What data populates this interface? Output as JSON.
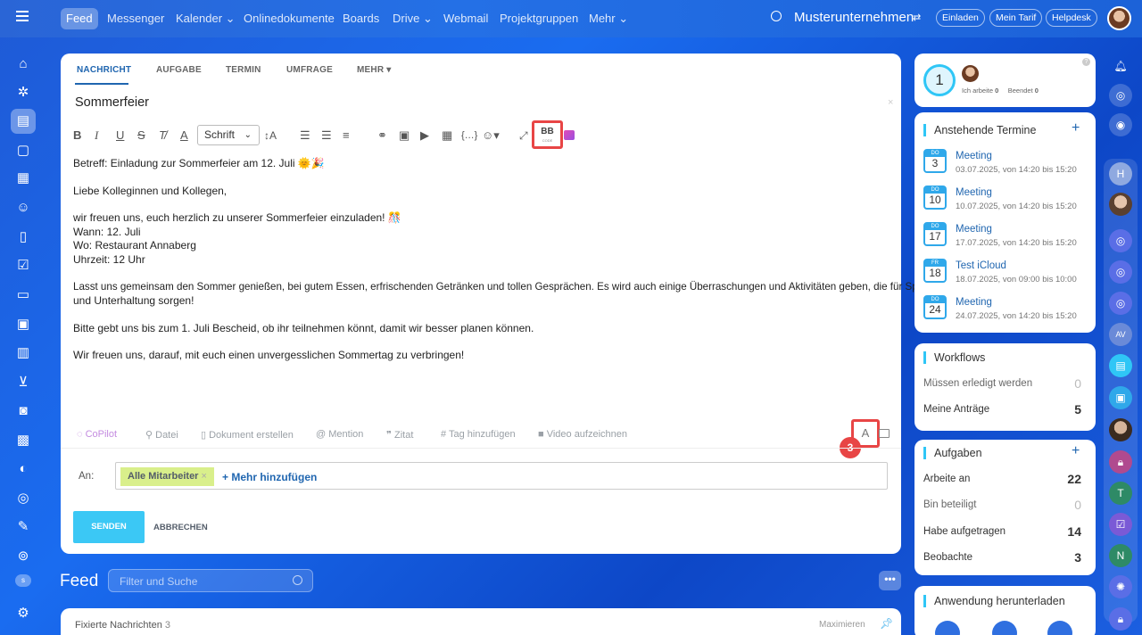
{
  "topnav": {
    "items": [
      "Feed",
      "Messenger",
      "Kalender",
      "Onlinedokumente",
      "Boards",
      "Drive",
      "Webmail",
      "Projektgruppen",
      "Mehr"
    ],
    "company": "Musterunternehmen",
    "invite": "Einladen",
    "tariff": "Mein Tarif",
    "helpdesk": "Helpdesk"
  },
  "composer": {
    "tabs": [
      "NACHRICHT",
      "AUFGABE",
      "TERMIN",
      "UMFRAGE",
      "MEHR"
    ],
    "title": "Sommerfeier",
    "font_select": "Schrift",
    "bb_label": "BB",
    "bb_sub": "CODE",
    "body": [
      "Betreff: Einladung zur Sommerfeier am 12. Juli 🌞🎉",
      "Liebe Kolleginnen und Kollegen,",
      "wir freuen uns, euch herzlich zu unserer Sommerfeier einzuladen! 🎊",
      "Wann: 12. Juli",
      "Wo: Restaurant Annaberg",
      "Uhrzeit: 12 Uhr",
      "Lasst uns gemeinsam den Sommer genießen, bei gutem Essen, erfrischenden Getränken und tollen Gesprächen. Es wird auch einige Überraschungen und Aktivitäten geben, die für Spaß",
      "und Unterhaltung sorgen!",
      "Bitte gebt uns bis zum 1. Juli Bescheid, ob ihr teilnehmen könnt, damit wir besser planen können.",
      "Wir freuen uns, darauf, mit euch einen unvergesslichen Sommertag zu verbringen!"
    ],
    "footer": {
      "copilot": "CoPilot",
      "file": "Datei",
      "doc": "Dokument erstellen",
      "mention": "Mention",
      "quote": "Zitat",
      "tag": "Tag hinzufügen",
      "video": "Video aufzeichnen",
      "format": "A",
      "step": "3"
    },
    "to_label": "An:",
    "recipient": "Alle Mitarbeiter",
    "add_more": "+ Mehr hinzufügen",
    "send": "SENDEN",
    "cancel": "ABBRECHEN"
  },
  "feed": {
    "title": "Feed",
    "filter_placeholder": "Filter und Suche",
    "pinned": "Fixierte Nachrichten",
    "pinned_count": "3",
    "maximize": "Maximieren"
  },
  "status": {
    "count": "1",
    "working_label": "Ich arbeite",
    "working": "0",
    "done_label": "Beendet",
    "done": "0"
  },
  "events": {
    "title": "Anstehende Termine",
    "items": [
      {
        "day": "DO",
        "num": "3",
        "title": "Meeting",
        "time": "03.07.2025, von 14:20 bis 15:20"
      },
      {
        "day": "DO",
        "num": "10",
        "title": "Meeting",
        "time": "10.07.2025, von 14:20 bis 15:20"
      },
      {
        "day": "DO",
        "num": "17",
        "title": "Meeting",
        "time": "17.07.2025, von 14:20 bis 15:20"
      },
      {
        "day": "FR",
        "num": "18",
        "title": "Test iCloud",
        "time": "18.07.2025, von 09:00 bis 10:00"
      },
      {
        "day": "DO",
        "num": "24",
        "title": "Meeting",
        "time": "24.07.2025, von 14:20 bis 15:20"
      }
    ]
  },
  "workflows": {
    "title": "Workflows",
    "rows": [
      {
        "label": "Müssen erledigt werden",
        "value": "0"
      },
      {
        "label": "Meine Anträge",
        "value": "5"
      }
    ]
  },
  "tasks": {
    "title": "Aufgaben",
    "rows": [
      {
        "label": "Arbeite an",
        "value": "22"
      },
      {
        "label": "Bin beteiligt",
        "value": "0"
      },
      {
        "label": "Habe aufgetragen",
        "value": "14"
      },
      {
        "label": "Beobachte",
        "value": "3"
      }
    ]
  },
  "download": {
    "title": "Anwendung herunterladen"
  },
  "colors": {
    "accent": "#2066b0",
    "send": "#3bc8f5",
    "highlight": "#e84545",
    "recipient": "#d9ef8b"
  }
}
